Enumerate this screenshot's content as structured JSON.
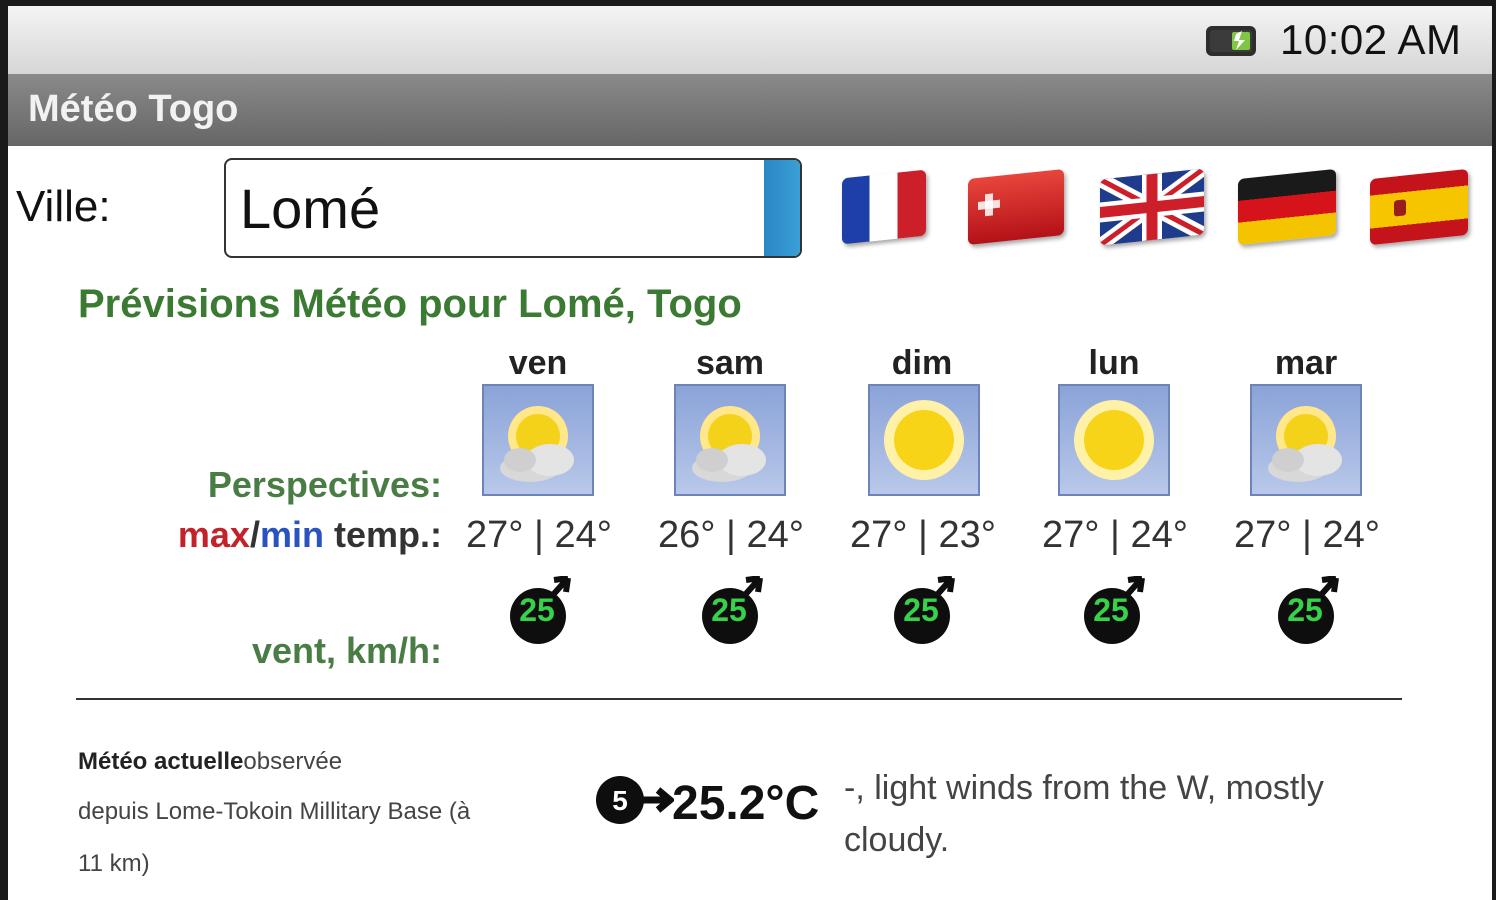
{
  "status_bar": {
    "time": "10:02 AM",
    "battery_icon": "battery-icon"
  },
  "app": {
    "title": "Météo Togo"
  },
  "city": {
    "label": "Ville:",
    "value": "Lomé"
  },
  "languages": [
    {
      "name": "france-flag-icon",
      "colors": [
        "#1e3ea8",
        "#ffffff",
        "#cc1f2a"
      ]
    },
    {
      "name": "switzerland-flag-icon",
      "colors": [
        "#d62b2b"
      ]
    },
    {
      "name": "uk-flag-icon",
      "colors": [
        "#1f3b8c",
        "#ffffff",
        "#cc1f2a"
      ]
    },
    {
      "name": "germany-flag-icon",
      "colors": [
        "#1a1a1a",
        "#d6121a",
        "#f4c400"
      ]
    },
    {
      "name": "spain-flag-icon",
      "colors": [
        "#c4131a",
        "#f6c500"
      ]
    }
  ],
  "forecast": {
    "heading": "Prévisions Météo pour Lomé, Togo",
    "labels": {
      "outlook": "Perspectives:",
      "max": "max",
      "slash": "/",
      "min": "min",
      "temp": " temp.:",
      "wind": "vent, km/h:"
    },
    "days": [
      {
        "day": "ven",
        "icon": "partly-cloudy-icon",
        "temp": "27° | 24°",
        "wind": "25"
      },
      {
        "day": "sam",
        "icon": "partly-cloudy-icon",
        "temp": "26° | 24°",
        "wind": "25"
      },
      {
        "day": "dim",
        "icon": "sunny-icon",
        "temp": "27° | 23°",
        "wind": "25"
      },
      {
        "day": "lun",
        "icon": "sunny-icon",
        "temp": "27° | 24°",
        "wind": "25"
      },
      {
        "day": "mar",
        "icon": "partly-cloudy-icon",
        "temp": "27° | 24°",
        "wind": "25"
      }
    ]
  },
  "current": {
    "title_bold": "Météo actuelle",
    "title_rest": "observée",
    "source_line": "depuis Lome-Tokoin Millitary Base (à",
    "distance": "11 km)",
    "wind_badge": "5",
    "temperature": "25.2°C",
    "description": "-, light winds from the W, mostly cloudy."
  }
}
